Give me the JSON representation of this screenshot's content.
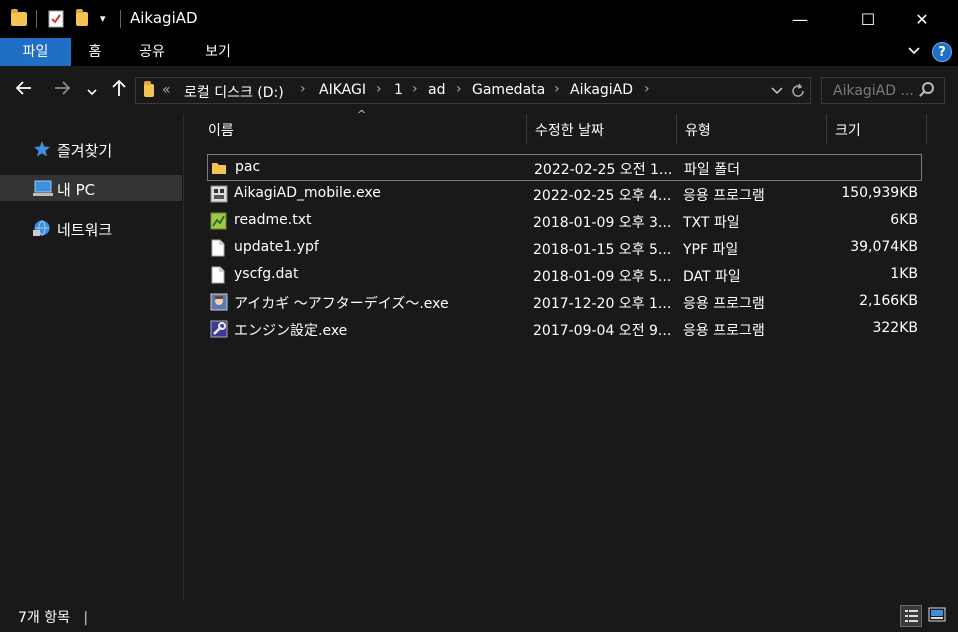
{
  "window": {
    "title": "AikagiAD",
    "minimize_glyph": "—",
    "maximize_glyph": "☐",
    "close_glyph": "✕"
  },
  "ribbon": {
    "tabs": [
      {
        "label": "파일"
      },
      {
        "label": "홈"
      },
      {
        "label": "공유"
      },
      {
        "label": "보기"
      }
    ],
    "help_glyph": "?"
  },
  "address": {
    "overflow": "«",
    "breadcrumbs": [
      {
        "label": "로컬 디스크 (D:)"
      },
      {
        "label": "AIKAGI"
      },
      {
        "label": "1"
      },
      {
        "label": "ad"
      },
      {
        "label": "Gamedata"
      },
      {
        "label": "AikagiAD"
      }
    ]
  },
  "search": {
    "placeholder": "AikagiAD ..."
  },
  "nav_pane": {
    "items": [
      {
        "label": "즐겨찾기",
        "icon": "star-icon"
      },
      {
        "label": "내 PC",
        "icon": "computer-icon",
        "selected": true
      },
      {
        "label": "네트워크",
        "icon": "network-icon"
      }
    ]
  },
  "columns": {
    "name": "이름",
    "modified": "수정한 날짜",
    "type": "유형",
    "size": "크기"
  },
  "files": [
    {
      "name": "pac",
      "modified": "2022-02-25 오전 1...",
      "type": "파일 폴더",
      "size": "",
      "icon": "folder-icon"
    },
    {
      "name": "AikagiAD_mobile.exe",
      "modified": "2022-02-25 오후 4...",
      "type": "응용 프로그램",
      "size": "150,939KB",
      "icon": "app-icon"
    },
    {
      "name": "readme.txt",
      "modified": "2018-01-09 오후 3...",
      "type": "TXT 파일",
      "size": "6KB",
      "icon": "text-file-icon"
    },
    {
      "name": "update1.ypf",
      "modified": "2018-01-15 오후 5...",
      "type": "YPF 파일",
      "size": "39,074KB",
      "icon": "file-icon"
    },
    {
      "name": "yscfg.dat",
      "modified": "2018-01-09 오후 5...",
      "type": "DAT 파일",
      "size": "1KB",
      "icon": "file-icon"
    },
    {
      "name": "アイカギ ～アフターデイズ～.exe",
      "modified": "2017-12-20 오후 1...",
      "type": "응용 프로그램",
      "size": "2,166KB",
      "icon": "game-icon"
    },
    {
      "name": "エンジン設定.exe",
      "modified": "2017-09-04 오전 9...",
      "type": "응용 프로그램",
      "size": "322KB",
      "icon": "settings-app-icon"
    }
  ],
  "status": {
    "item_count": "7개 항목",
    "cursor": "|"
  },
  "colors": {
    "accent": "#1f6fc6",
    "background": "#191919",
    "titlebar": "#000000",
    "folder": "#f3c454"
  }
}
